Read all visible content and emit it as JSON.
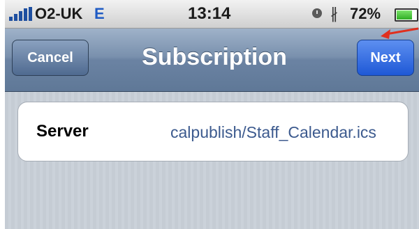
{
  "status_bar": {
    "carrier": "O2-UK",
    "network": "E",
    "time": "13:14",
    "battery": "72%",
    "battery_level": 0.72,
    "icons": [
      "signal-icon",
      "alarm-icon",
      "bluetooth-icon",
      "battery-icon"
    ]
  },
  "nav": {
    "cancel_label": "Cancel",
    "title": "Subscription",
    "next_label": "Next"
  },
  "form": {
    "server_label": "Server",
    "server_value": "calpublish/Staff_Calendar.ics"
  },
  "annotation": {
    "arrow_color": "#e0301e"
  }
}
